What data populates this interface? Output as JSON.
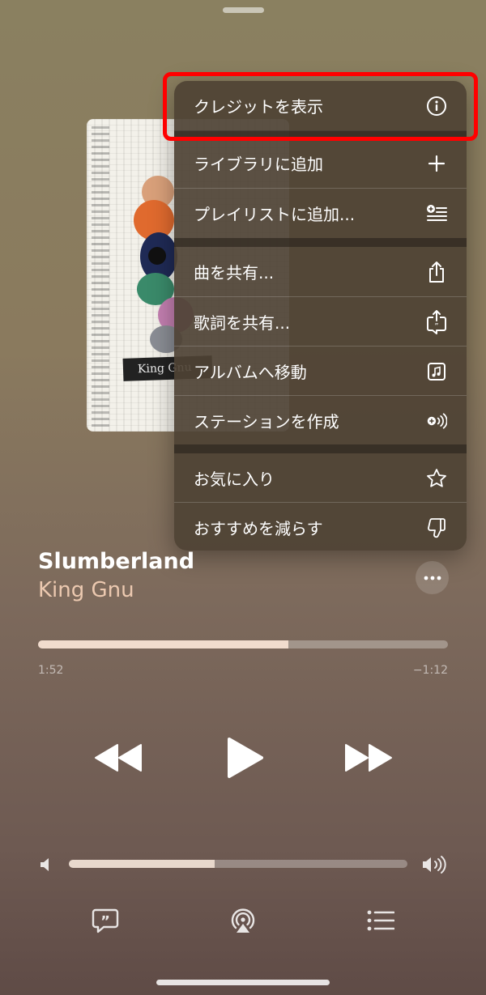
{
  "menu": {
    "items": [
      {
        "label": "クレジットを表示",
        "icon": "info-icon"
      },
      {
        "label": "ライブラリに追加",
        "icon": "plus-icon"
      },
      {
        "label": "プレイリストに追加...",
        "icon": "add-to-playlist-icon"
      },
      {
        "label": "曲を共有...",
        "icon": "share-icon"
      },
      {
        "label": "歌詞を共有...",
        "icon": "share-lyrics-icon"
      },
      {
        "label": "アルバムへ移動",
        "icon": "music-note-square-icon"
      },
      {
        "label": "ステーションを作成",
        "icon": "station-icon"
      },
      {
        "label": "お気に入り",
        "icon": "star-icon"
      },
      {
        "label": "おすすめを減らす",
        "icon": "thumbs-down-icon"
      }
    ]
  },
  "album": {
    "banner_text": "King Gnu"
  },
  "track": {
    "title": "Slumberland",
    "artist": "King Gnu",
    "elapsed": "1:52",
    "remaining": "−1:12",
    "progress": 0.61
  },
  "volume": {
    "level": 0.43
  },
  "colors": {
    "highlight": "#ff0000",
    "artist": "#ecc9b0"
  }
}
